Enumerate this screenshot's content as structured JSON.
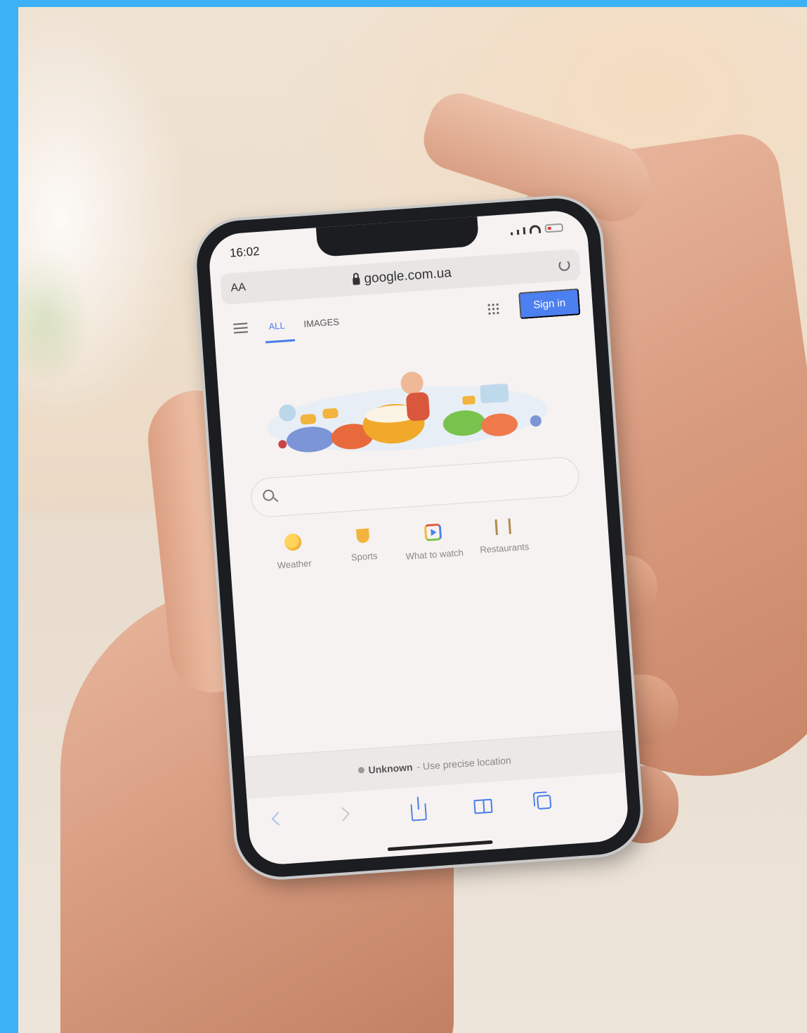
{
  "status_bar": {
    "time": "16:02"
  },
  "address_bar": {
    "text_size_label": "AA",
    "url": "google.com.ua"
  },
  "nav": {
    "tab_all": "ALL",
    "tab_images": "IMAGES",
    "sign_in_label": "Sign in"
  },
  "shortcuts": [
    {
      "label": "Weather",
      "icon": "weather-icon"
    },
    {
      "label": "Sports",
      "icon": "trophy-icon"
    },
    {
      "label": "What to watch",
      "icon": "play-icon"
    },
    {
      "label": "Restaurants",
      "icon": "fork-knife-icon"
    }
  ],
  "location": {
    "status": "Unknown",
    "action": "- Use precise location"
  },
  "colors": {
    "frame": "#3bb2f5",
    "accent": "#4c7ff0"
  }
}
